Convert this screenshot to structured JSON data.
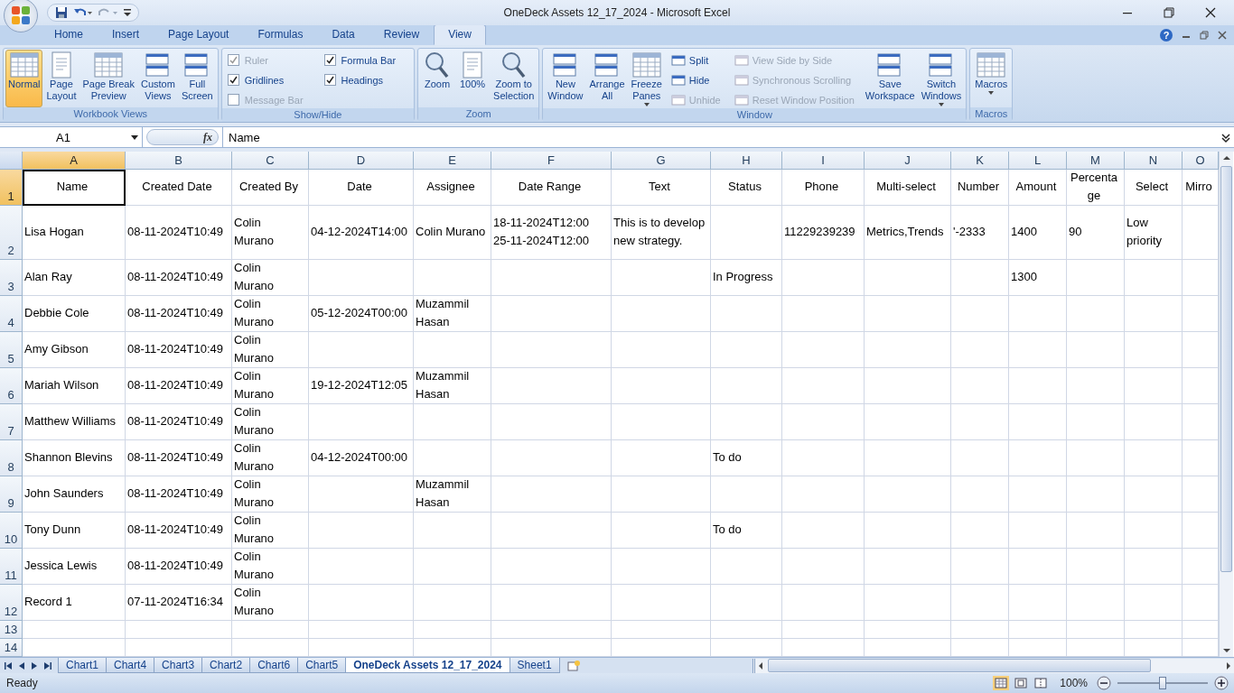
{
  "window": {
    "title": "OneDeck Assets 12_17_2024 - Microsoft Excel"
  },
  "ribbon": {
    "tabs": [
      {
        "label": "Home",
        "selected": false
      },
      {
        "label": "Insert",
        "selected": false
      },
      {
        "label": "Page Layout",
        "selected": false
      },
      {
        "label": "Formulas",
        "selected": false
      },
      {
        "label": "Data",
        "selected": false
      },
      {
        "label": "Review",
        "selected": false
      },
      {
        "label": "View",
        "selected": true
      }
    ],
    "help": "?",
    "groups": [
      {
        "label": "Workbook Views",
        "items": [
          {
            "kind": "large",
            "label": "Normal",
            "selected": true
          },
          {
            "kind": "large",
            "label": "Page\nLayout",
            "selected": false
          },
          {
            "kind": "large",
            "label": "Page Break\nPreview",
            "selected": false
          },
          {
            "kind": "large",
            "label": "Custom\nViews",
            "selected": false
          },
          {
            "kind": "large",
            "label": "Full\nScreen",
            "selected": false
          }
        ]
      },
      {
        "label": "Show/Hide",
        "items": [
          {
            "kind": "check",
            "label": "Ruler",
            "checked": true,
            "disabled": true
          },
          {
            "kind": "check",
            "label": "Gridlines",
            "checked": true,
            "disabled": false
          },
          {
            "kind": "check",
            "label": "Message Bar",
            "checked": false,
            "disabled": true
          },
          {
            "kind": "check",
            "label": "Formula Bar",
            "checked": true,
            "disabled": false
          },
          {
            "kind": "check",
            "label": "Headings",
            "checked": true,
            "disabled": false
          }
        ]
      },
      {
        "label": "Zoom",
        "items": [
          {
            "kind": "large",
            "label": "Zoom"
          },
          {
            "kind": "large",
            "label": "100%"
          },
          {
            "kind": "large",
            "label": "Zoom to\nSelection"
          }
        ]
      },
      {
        "label": "Window",
        "items": [
          {
            "kind": "large",
            "label": "New\nWindow"
          },
          {
            "kind": "large",
            "label": "Arrange\nAll"
          },
          {
            "kind": "large",
            "label": "Freeze\nPanes",
            "dropdown": true
          },
          {
            "kind": "small",
            "label": "Split",
            "disabled": false
          },
          {
            "kind": "small",
            "label": "Hide",
            "disabled": false
          },
          {
            "kind": "small",
            "label": "Unhide",
            "disabled": true
          },
          {
            "kind": "small",
            "label": "View Side by Side",
            "disabled": true
          },
          {
            "kind": "small",
            "label": "Synchronous Scrolling",
            "disabled": true
          },
          {
            "kind": "small",
            "label": "Reset Window Position",
            "disabled": true
          },
          {
            "kind": "large",
            "label": "Save\nWorkspace"
          },
          {
            "kind": "large",
            "label": "Switch\nWindows",
            "dropdown": true
          }
        ]
      },
      {
        "label": "Macros",
        "items": [
          {
            "kind": "large",
            "label": "Macros",
            "dropdown": true
          }
        ]
      }
    ]
  },
  "formula_bar": {
    "name_box": "A1",
    "fx": "fx",
    "value": "Name"
  },
  "sheet": {
    "columns": [
      {
        "label": "A",
        "selected": true
      },
      {
        "label": "B",
        "selected": false
      },
      {
        "label": "C",
        "selected": false
      },
      {
        "label": "D",
        "selected": false
      },
      {
        "label": "E",
        "selected": false
      },
      {
        "label": "F",
        "selected": false
      },
      {
        "label": "G",
        "selected": false
      },
      {
        "label": "H",
        "selected": false
      },
      {
        "label": "I",
        "selected": false
      },
      {
        "label": "J",
        "selected": false
      },
      {
        "label": "K",
        "selected": false
      },
      {
        "label": "L",
        "selected": false
      },
      {
        "label": "M",
        "selected": false
      },
      {
        "label": "N",
        "selected": false
      },
      {
        "label": "O",
        "selected": false
      }
    ],
    "rows": [
      {
        "label": "1",
        "selected": true,
        "cells": [
          "Name",
          "Created Date",
          "Created By",
          "Date",
          "Assignee",
          "Date Range",
          "Text",
          "Status",
          "Phone",
          "Multi-select",
          "Number",
          "Amount",
          "Percentage",
          "Select",
          "Mirro"
        ]
      },
      {
        "label": "2",
        "selected": false,
        "cells": [
          "Lisa Hogan",
          "08-11-2024T10:49",
          "Colin Murano",
          "04-12-2024T14:00",
          "Colin Murano",
          "18-11-2024T12:00 25-11-2024T12:00",
          "This is to develop new strategy.",
          null,
          "11229239239",
          "Metrics,Trends",
          "'-2333",
          "1400",
          "90",
          "Low priority"
        ]
      },
      {
        "label": "3",
        "selected": false,
        "cells": [
          "Alan Ray",
          "08-11-2024T10:49",
          "Colin Murano",
          null,
          null,
          null,
          null,
          "In Progress",
          null,
          null,
          null,
          "1300"
        ]
      },
      {
        "label": "4",
        "selected": false,
        "cells": [
          "Debbie Cole",
          "08-11-2024T10:49",
          "Colin Murano",
          "05-12-2024T00:00",
          "Muzammil Hasan"
        ]
      },
      {
        "label": "5",
        "selected": false,
        "cells": [
          "Amy Gibson",
          "08-11-2024T10:49",
          "Colin Murano"
        ]
      },
      {
        "label": "6",
        "selected": false,
        "cells": [
          "Mariah Wilson",
          "08-11-2024T10:49",
          "Colin Murano",
          "19-12-2024T12:05",
          "Muzammil Hasan"
        ]
      },
      {
        "label": "7",
        "selected": false,
        "cells": [
          "Matthew Williams",
          "08-11-2024T10:49",
          "Colin Murano"
        ]
      },
      {
        "label": "8",
        "selected": false,
        "cells": [
          "Shannon Blevins",
          "08-11-2024T10:49",
          "Colin Murano",
          "04-12-2024T00:00",
          null,
          null,
          null,
          "To do"
        ]
      },
      {
        "label": "9",
        "selected": false,
        "cells": [
          "John Saunders",
          "08-11-2024T10:49",
          "Colin Murano",
          null,
          "Muzammil Hasan"
        ]
      },
      {
        "label": "10",
        "selected": false,
        "cells": [
          "Tony Dunn",
          "08-11-2024T10:49",
          "Colin Murano",
          null,
          null,
          null,
          null,
          "To do"
        ]
      },
      {
        "label": "11",
        "selected": false,
        "cells": [
          "Jessica Lewis",
          "08-11-2024T10:49",
          "Colin Murano"
        ]
      },
      {
        "label": "12",
        "selected": false,
        "cells": [
          "Record 1",
          "07-11-2024T16:34",
          "Colin Murano"
        ]
      },
      {
        "label": "13",
        "selected": false
      },
      {
        "label": "14",
        "selected": false
      }
    ]
  },
  "sheet_tabs": [
    {
      "label": "Chart1",
      "selected": false
    },
    {
      "label": "Chart4",
      "selected": false
    },
    {
      "label": "Chart3",
      "selected": false
    },
    {
      "label": "Chart2",
      "selected": false
    },
    {
      "label": "Chart6",
      "selected": false
    },
    {
      "label": "Chart5",
      "selected": false
    },
    {
      "label": "OneDeck Assets 12_17_2024",
      "selected": true
    },
    {
      "label": "Sheet1",
      "selected": false
    }
  ],
  "status_bar": {
    "text": "Ready",
    "zoom": "100%",
    "zoom_slider": {
      "level": 0.5
    }
  }
}
